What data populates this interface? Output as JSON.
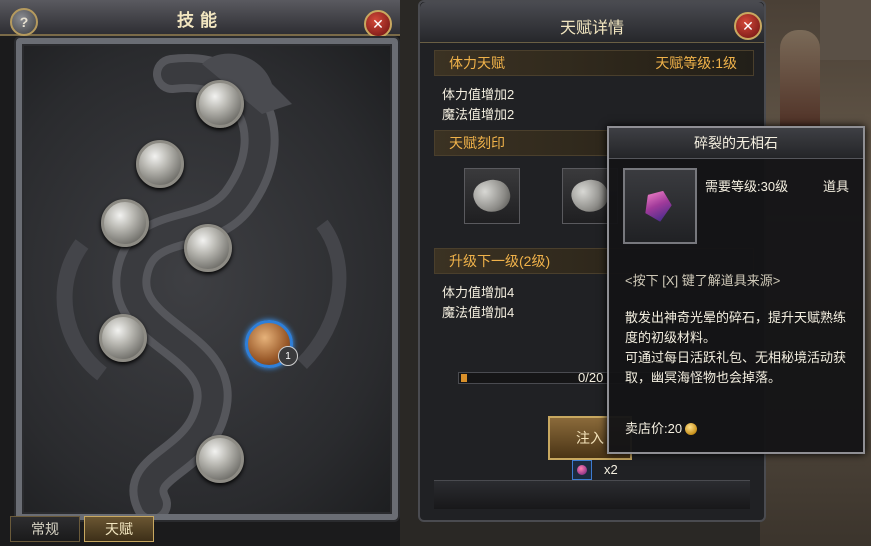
{
  "skills_panel": {
    "title": "技能",
    "help_label": "?",
    "close_label": "✕",
    "active_node_level": "1",
    "tabs": [
      {
        "label": "常规"
      },
      {
        "label": "天赋"
      }
    ]
  },
  "talent_details": {
    "title": "天赋详情",
    "close_label": "✕",
    "current": {
      "name": "体力天赋",
      "level_text": "天赋等级:1级",
      "effects": [
        "体力值增加2",
        "魔法值增加2"
      ]
    },
    "imprint_label": "天赋刻印",
    "next": {
      "label": "升级下一级(2级)",
      "effects": [
        "体力值增加4",
        "魔法值增加4"
      ]
    },
    "progress_text": "0/20",
    "progress_fraction": 0.0,
    "inject_label": "注入",
    "material_count": "x2"
  },
  "tooltip": {
    "title": "碎裂的无相石",
    "required_level": "需要等级:30级",
    "item_type": "道具",
    "hint": "<按下 [X] 键了解道具来源>",
    "description": [
      "散发出神奇光晕的碎石，提升天赋熟练度的初级材料。",
      "可通过每日活跃礼包、无相秘境活动获取，幽冥海怪物也会掉落。"
    ],
    "sell_price": "卖店价:20"
  }
}
